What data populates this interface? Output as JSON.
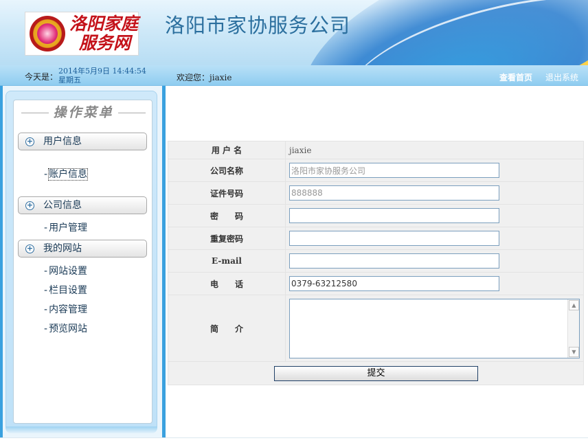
{
  "header": {
    "logo_text_line1": "洛阳家庭",
    "logo_text_line2": "服务网",
    "site_title": "洛阳市家协服务公司"
  },
  "infobar": {
    "today_label": "今天是：",
    "today_value": "2014年5月9日 14:44:54 星期五",
    "welcome_label": "欢迎您：",
    "username": "jiaxie",
    "home_link": "查看首页",
    "logout_link": "退出系统"
  },
  "sidebar": {
    "title": "操作菜单",
    "groups": [
      {
        "label": "用户信息",
        "items": [
          {
            "label": "账户信息"
          }
        ]
      },
      {
        "label": "公司信息",
        "items": [
          {
            "label": "用户管理"
          }
        ]
      },
      {
        "label": "我的网站",
        "items": [
          {
            "label": "网站设置"
          },
          {
            "label": "栏目设置"
          },
          {
            "label": "内容管理"
          },
          {
            "label": "预览网站"
          }
        ]
      }
    ]
  },
  "form": {
    "username_label": "用 户 名",
    "username_value": "jiaxie",
    "company_label": "公司名称",
    "company_value": "洛阳市家协服务公司",
    "cert_label": "证件号码",
    "cert_value": "888888",
    "password_label": "密　　码",
    "password_value": "",
    "repeat_password_label": "重复密码",
    "repeat_password_value": "",
    "email_label": "E-mail",
    "email_value": "",
    "phone_label": "电　　话",
    "phone_value": "0379-63212580",
    "intro_label": "简　　介",
    "intro_value": "",
    "submit_label": "提交"
  },
  "colors": {
    "accent_blue": "#3aa1df",
    "title_blue": "#2b6f9e",
    "logo_red": "#c4121a",
    "banner_orange": "#f7a21b"
  }
}
